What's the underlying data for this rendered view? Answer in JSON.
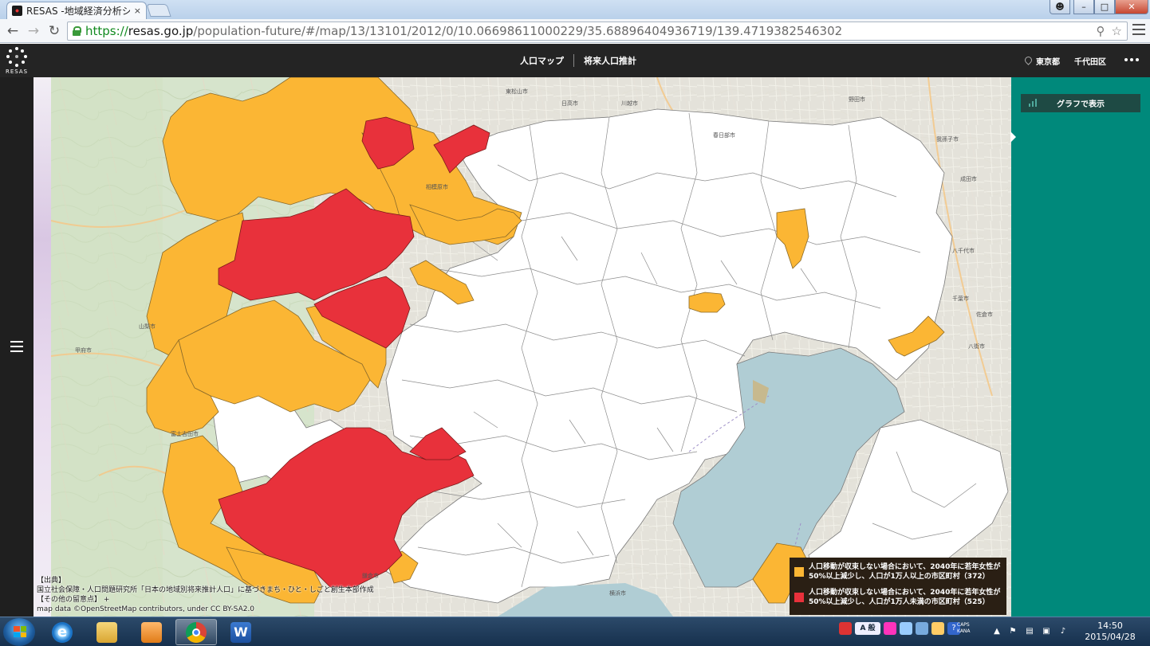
{
  "browser": {
    "tab_title": "RESAS -地域経済分析シ",
    "tab_close": "×",
    "url_scheme": "https://",
    "url_host": "resas.go.jp",
    "url_path": "/population-future/#/map/13/13101/2012/0/10.06698611000229/35.68896404936719/139.4719382546302",
    "back_glyph": "←",
    "forward_glyph": "→",
    "reload_glyph": "↻"
  },
  "app": {
    "logo_text": "RESAS",
    "nav": [
      "人口マップ",
      "将来人口推計"
    ],
    "prefecture": "東京都",
    "city": "千代田区"
  },
  "panel": {
    "graph_button": "グラフで表示"
  },
  "source": {
    "heading": "【出典】",
    "line1": "国立社会保障・人口問題研究所「日本の地域別将来推計人口」に基づきまち・ひと・しごと創生本部作成",
    "notes": "【その他の留意点】 +",
    "map_credit": "map data ©OpenStreetMap contributors, under CC BY-SA2.0"
  },
  "legend": {
    "items": [
      {
        "color": "#fbb634",
        "label": "人口移動が収束しない場合において、2040年に若年女性が50%以上減少し、人口が1万人以上の市区町村（372）"
      },
      {
        "color": "#e8313b",
        "label": "人口移動が収束しない場合において、2040年に若年女性が50%以上減少し、人口が1万人未満の市区町村（525）"
      }
    ]
  },
  "map_labels": [
    "東松山市",
    "日高市",
    "川越市",
    "春日部市",
    "野田市",
    "我孫子市",
    "成田市",
    "八千代市",
    "千葉市",
    "佐倉市",
    "八街市",
    "山梨市",
    "甲府市",
    "富士吉田市",
    "相模原市",
    "鎌倉市",
    "横浜市"
  ],
  "colors": {
    "orange": "#fbb634",
    "red": "#e8313b",
    "panel": "#00897b",
    "header": "#242424"
  },
  "taskbar": {
    "ime": "A 般",
    "caps": "CAPS",
    "kana": "KANA",
    "time": "14:50",
    "date": "2015/04/28"
  }
}
